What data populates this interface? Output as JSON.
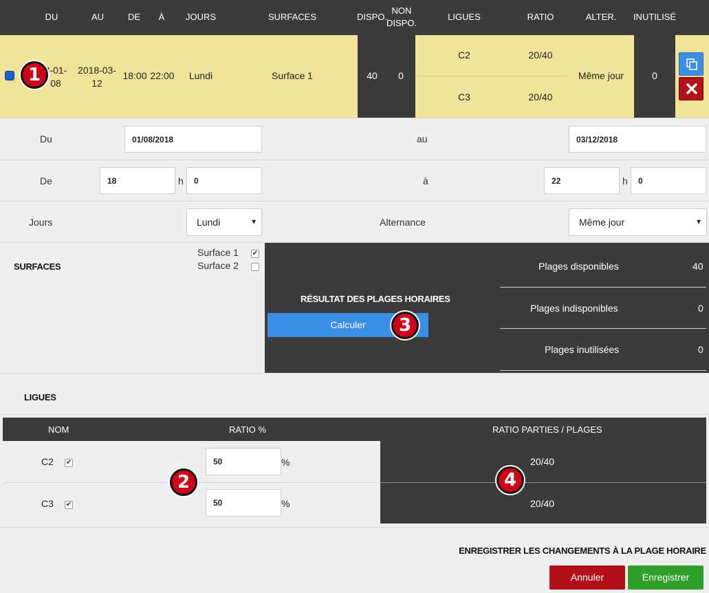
{
  "header": {
    "du": "DU",
    "au": "AU",
    "de": "DE",
    "a": "À",
    "jours": "JOURS",
    "surfaces": "SURFACES",
    "dispo": "DISPO.",
    "non_dispo_1": "NON",
    "non_dispo_2": "DISPO.",
    "ligues": "LIGUES",
    "ratio": "RATIO",
    "alter": "ALTER.",
    "inutilise": "INUTILISÉ"
  },
  "row": {
    "du_1": "8-01-",
    "du_2": "08",
    "au_1": "2018-03-",
    "au_2": "12",
    "de": "18:00",
    "a": "22:00",
    "jours": "Lundi",
    "surfaces": "Surface 1",
    "dispo": "40",
    "non_dispo": "0",
    "ligues": [
      {
        "name": "C2",
        "ratio": "20/40"
      },
      {
        "name": "C3",
        "ratio": "20/40"
      }
    ],
    "alter": "Même jour",
    "inutilise": "0"
  },
  "form": {
    "du_label": "Du",
    "du_value": "01/08/2018",
    "au_label": "au",
    "au_value": "03/12/2018",
    "de_label": "De",
    "de_h": "18",
    "h_sep": "h",
    "de_m": "0",
    "a_label": "à",
    "a_h": "22",
    "a_m": "0",
    "jours_label": "Jours",
    "jours_value": "Lundi",
    "alternance_label": "Alternance",
    "alternance_value": "Même jour"
  },
  "surfaces": {
    "label": "SURFACES",
    "items": [
      {
        "name": "Surface 1",
        "checked": true
      },
      {
        "name": "Surface 2",
        "checked": false
      }
    ]
  },
  "results": {
    "title": "RÉSULTAT DES PLAGES HORAIRES",
    "calc_button": "Calculer",
    "stats": [
      {
        "label": "Plages disponibles",
        "value": "40"
      },
      {
        "label": "Plages indisponibles",
        "value": "0"
      },
      {
        "label": "Plages inutilisées",
        "value": "0"
      }
    ]
  },
  "ligues": {
    "label": "LIGUES",
    "col_nom": "NOM",
    "col_ratio": "RATIO %",
    "col_parties": "RATIO PARTIES / PLAGES",
    "rows": [
      {
        "name": "C2",
        "ratio": "50",
        "pct": "%",
        "parties": "20/40"
      },
      {
        "name": "C3",
        "ratio": "50",
        "pct": "%",
        "parties": "20/40"
      }
    ]
  },
  "footer": {
    "save_title": "ENREGISTRER LES CHANGEMENTS À LA PLAGE HORAIRE",
    "cancel": "Annuler",
    "save": "Enregistrer"
  },
  "badges": [
    "1",
    "2",
    "3",
    "4"
  ],
  "colors": {
    "dark": "#3b3b3b",
    "highlight": "#f1e397",
    "blue": "#3a8ee6",
    "red": "#b3111a",
    "green": "#2ea02a"
  }
}
